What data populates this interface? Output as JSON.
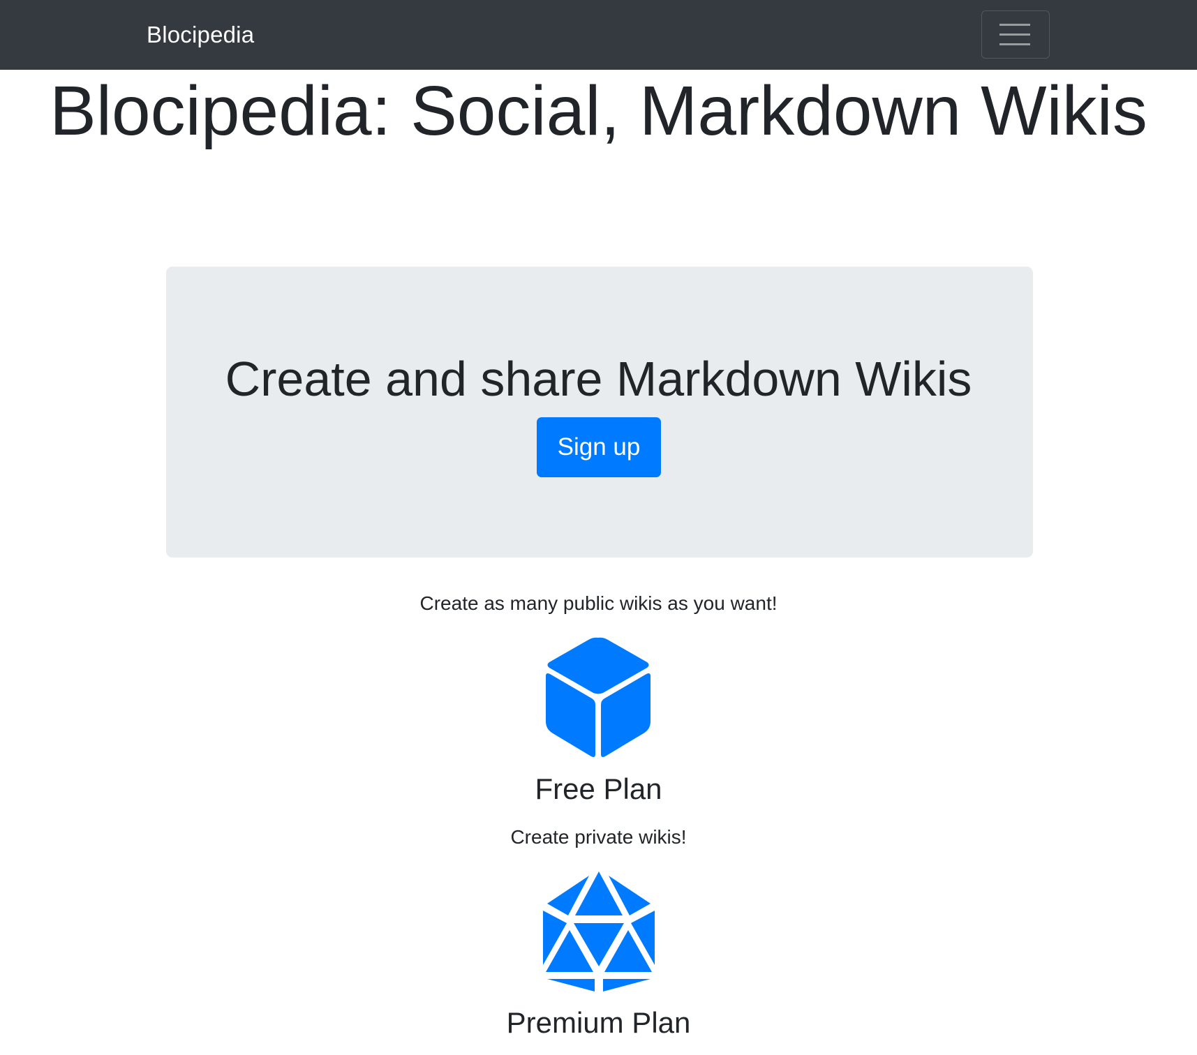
{
  "navbar": {
    "brand": "Blocipedia",
    "toggler_icon": "hamburger-menu-icon"
  },
  "page": {
    "title": "Blocipedia: Social, Markdown Wikis"
  },
  "jumbotron": {
    "heading": "Create and share Markdown Wikis",
    "signup_label": "Sign up"
  },
  "plans": [
    {
      "description": "Create as many public wikis as you want!",
      "icon": "box-icon",
      "name": "Free Plan"
    },
    {
      "description": "Create private wikis!",
      "icon": "gem-icon",
      "name": "Premium Plan"
    }
  ],
  "colors": {
    "navbar_bg": "#343a40",
    "primary": "#007bff",
    "jumbotron_bg": "#e9ecef",
    "text": "#212529"
  }
}
